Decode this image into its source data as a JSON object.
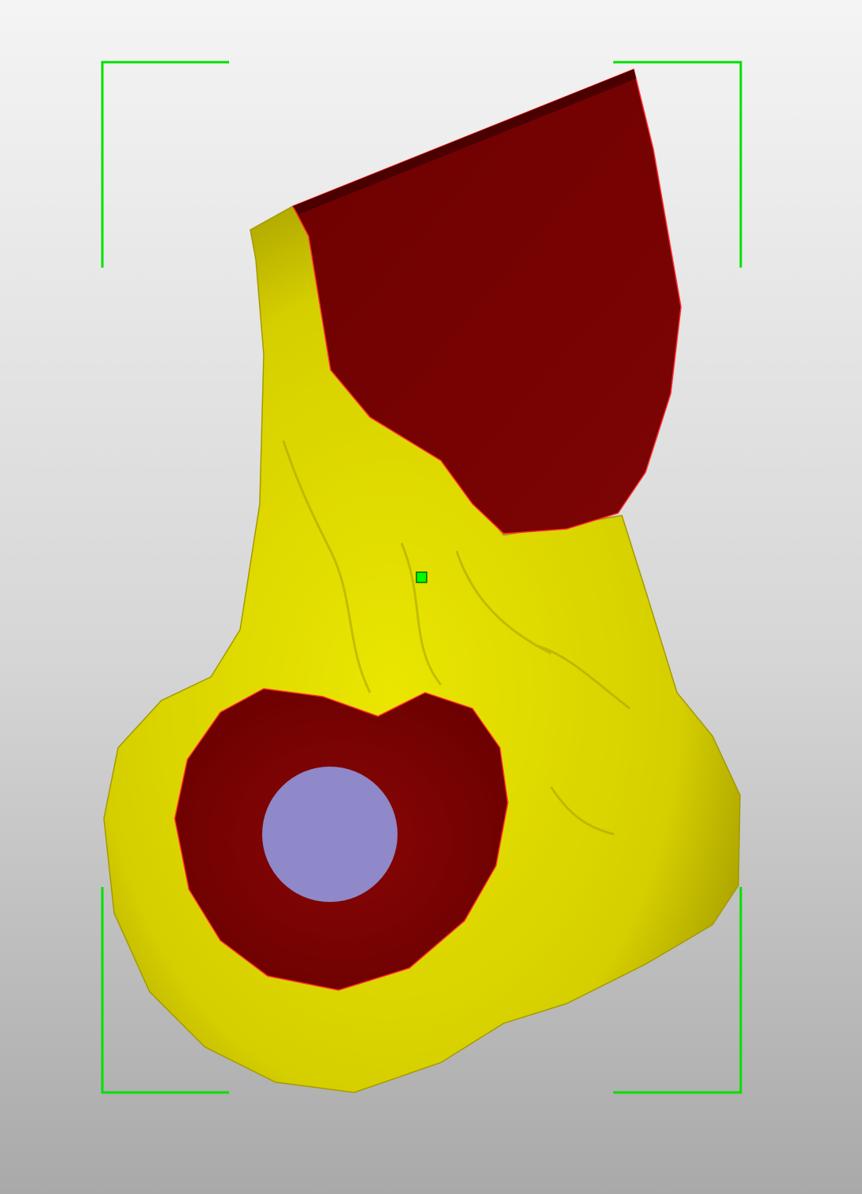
{
  "viewer": {
    "background_top": "#f4f4f4",
    "background_bottom": "#a9a9a9",
    "selection_bracket_color": "#00e000",
    "pivot_marker_color": "#00ff00"
  },
  "model": {
    "bone_color": "#e6e000",
    "cut_surface_color": "#7a0000",
    "cut_edge_color": "#ff2020",
    "drill_hole_color": "#8f88c9"
  }
}
